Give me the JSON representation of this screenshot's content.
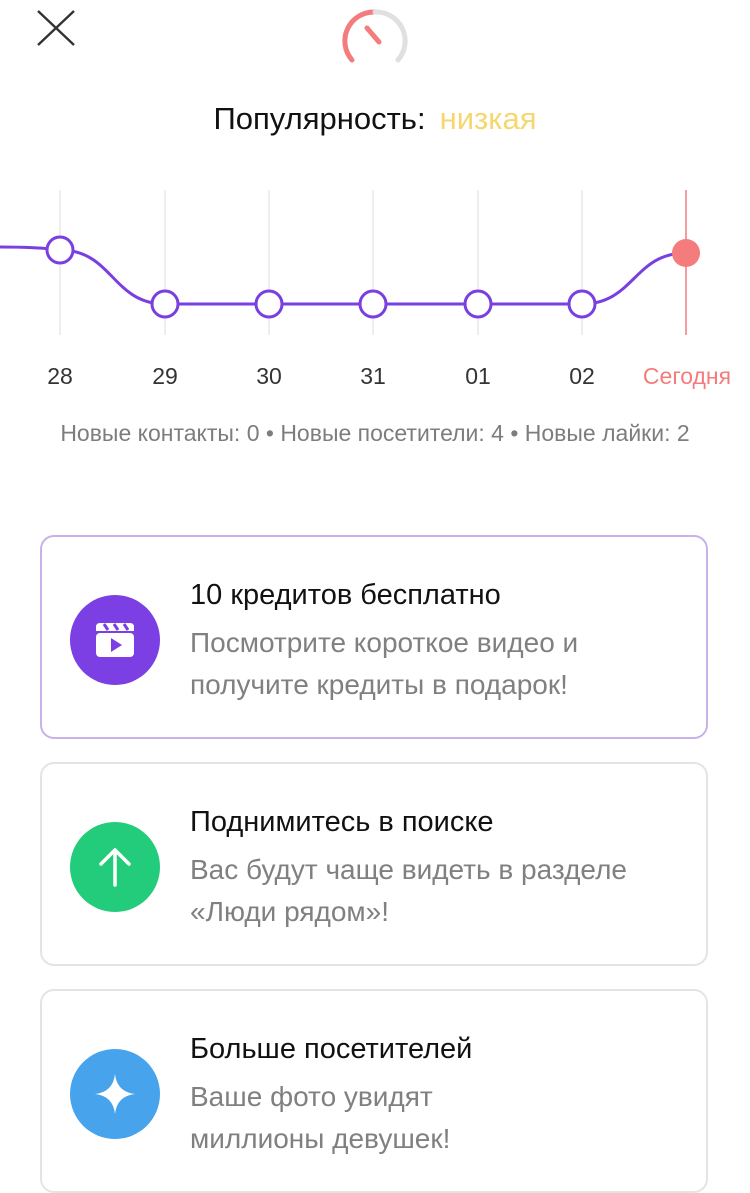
{
  "header": {
    "popularity_label": "Популярность:",
    "popularity_value": "низкая",
    "popularity_color": "#f5d76e"
  },
  "chart_data": {
    "type": "line",
    "categories": [
      "28",
      "29",
      "30",
      "31",
      "01",
      "02",
      "Сегодня"
    ],
    "values": [
      3.0,
      1.2,
      1.2,
      1.2,
      1.2,
      1.2,
      2.9
    ],
    "y_range": [
      0,
      4
    ],
    "line_color": "#7a3fe0",
    "today_color": "#f47c7c",
    "grid": "vertical",
    "yaxis_shown": false
  },
  "stats": {
    "text": "Новые контакты: 0 • Новые посетители: 4 • Новые лайки: 2"
  },
  "cards": [
    {
      "title": "10 кредитов бесплатно",
      "desc_line1": "Посмотрите короткое видео и",
      "desc_line2": "получите кредиты в подарок!",
      "icon": "video-clapper-icon",
      "color": "#7b3fe4"
    },
    {
      "title": "Поднимитесь в поиске",
      "desc_line1": "Вас будут чаще видеть в разделе",
      "desc_line2": "«Люди рядом»!",
      "icon": "arrow-up-icon",
      "color": "#22cc7a"
    },
    {
      "title": "Больше посетителей",
      "desc_line1": "Ваше фото увидят",
      "desc_line2": "миллионы девушек!",
      "icon": "sparkle-icon",
      "color": "#47a3ec"
    }
  ]
}
